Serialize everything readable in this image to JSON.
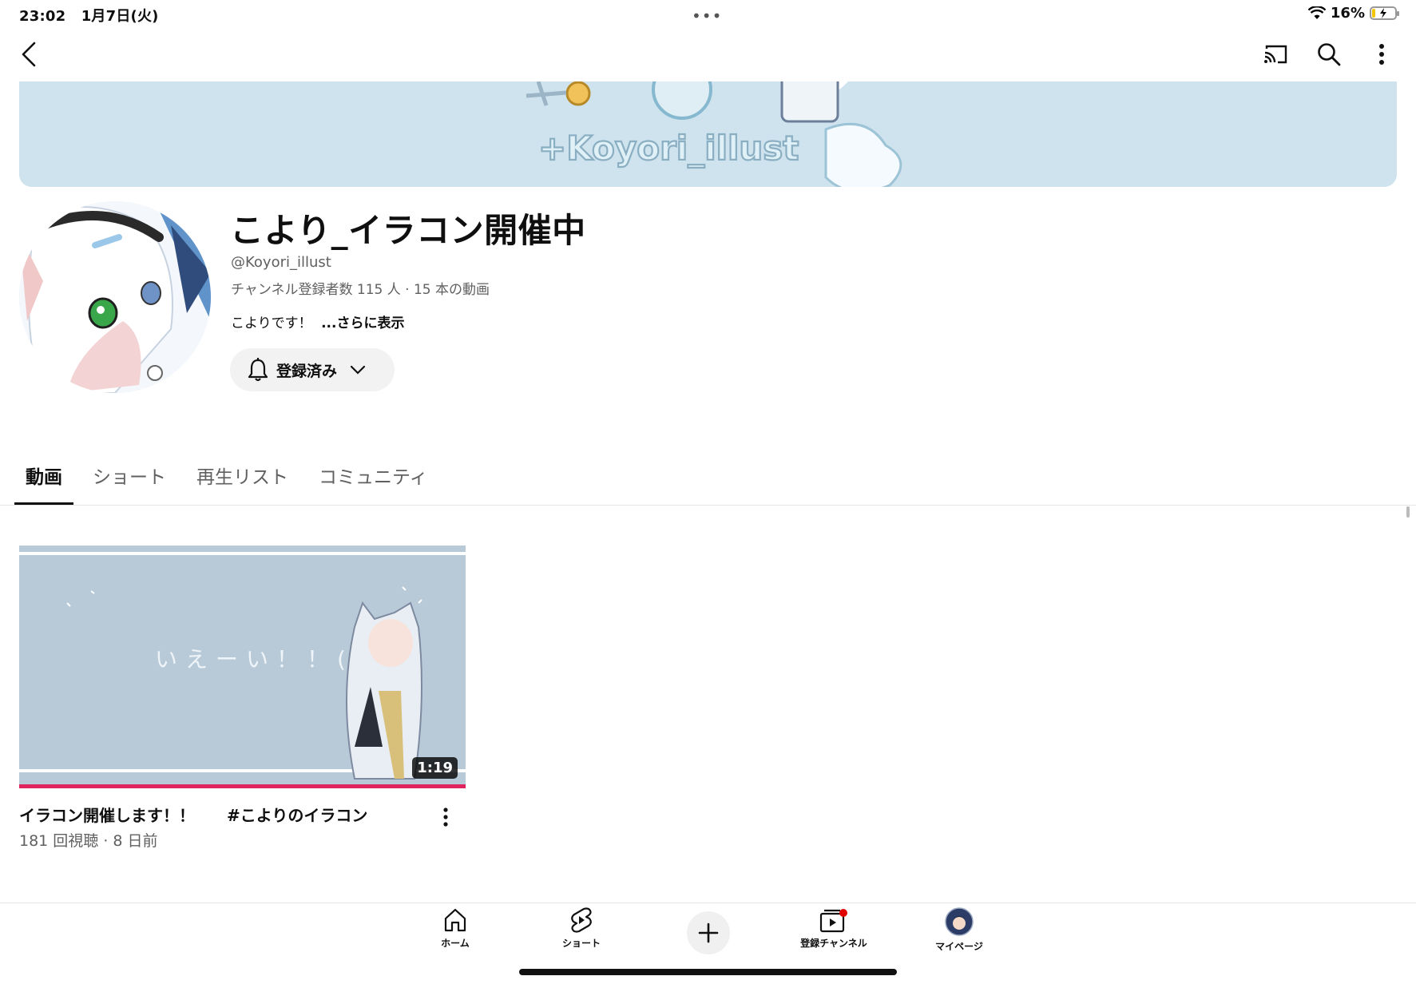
{
  "status_bar": {
    "time": "23:02",
    "date": "1月7日(火)",
    "multitask_dots": "•••",
    "battery": "16%",
    "battery_level": 0.16,
    "battery_color": "#f5c400",
    "icons": [
      "wifi-icon",
      "battery-icon"
    ]
  },
  "top_bar": {
    "icons": [
      "back-icon",
      "cast-icon",
      "search-icon",
      "more-vert-icon"
    ]
  },
  "channel": {
    "name": "こより_イラコン開催中",
    "handle": "@Koyori_illust",
    "stats": "チャンネル登録者数 115 人 ‧ 15 本の動画",
    "description": "こよりです！",
    "more_link": "...さらに表示",
    "subscribe_label": "登録済み"
  },
  "tabs": [
    {
      "label": "動画",
      "active": true
    },
    {
      "label": "ショート",
      "active": false
    },
    {
      "label": "再生リスト",
      "active": false
    },
    {
      "label": "コミュニティ",
      "active": false
    }
  ],
  "videos": [
    {
      "title": "イラコン開催します！！　　#こよりのイラコン",
      "meta": "181 回視聴 · 8 日前",
      "duration": "1:19",
      "watched_progress": 1.0,
      "progress_color": "#e0245e"
    }
  ],
  "bottom_nav": [
    {
      "label": "ホーム",
      "icon": "home-icon"
    },
    {
      "label": "ショート",
      "icon": "shorts-icon"
    },
    {
      "label": "",
      "icon": "plus-icon"
    },
    {
      "label": "登録チャンネル",
      "icon": "subscriptions-icon"
    },
    {
      "label": "マイページ",
      "icon": "avatar-icon"
    }
  ],
  "colors": {
    "accent_red": "#e0245e",
    "banner_bg": "#cfe3ee",
    "thumb_bg": "#b8cad8"
  }
}
